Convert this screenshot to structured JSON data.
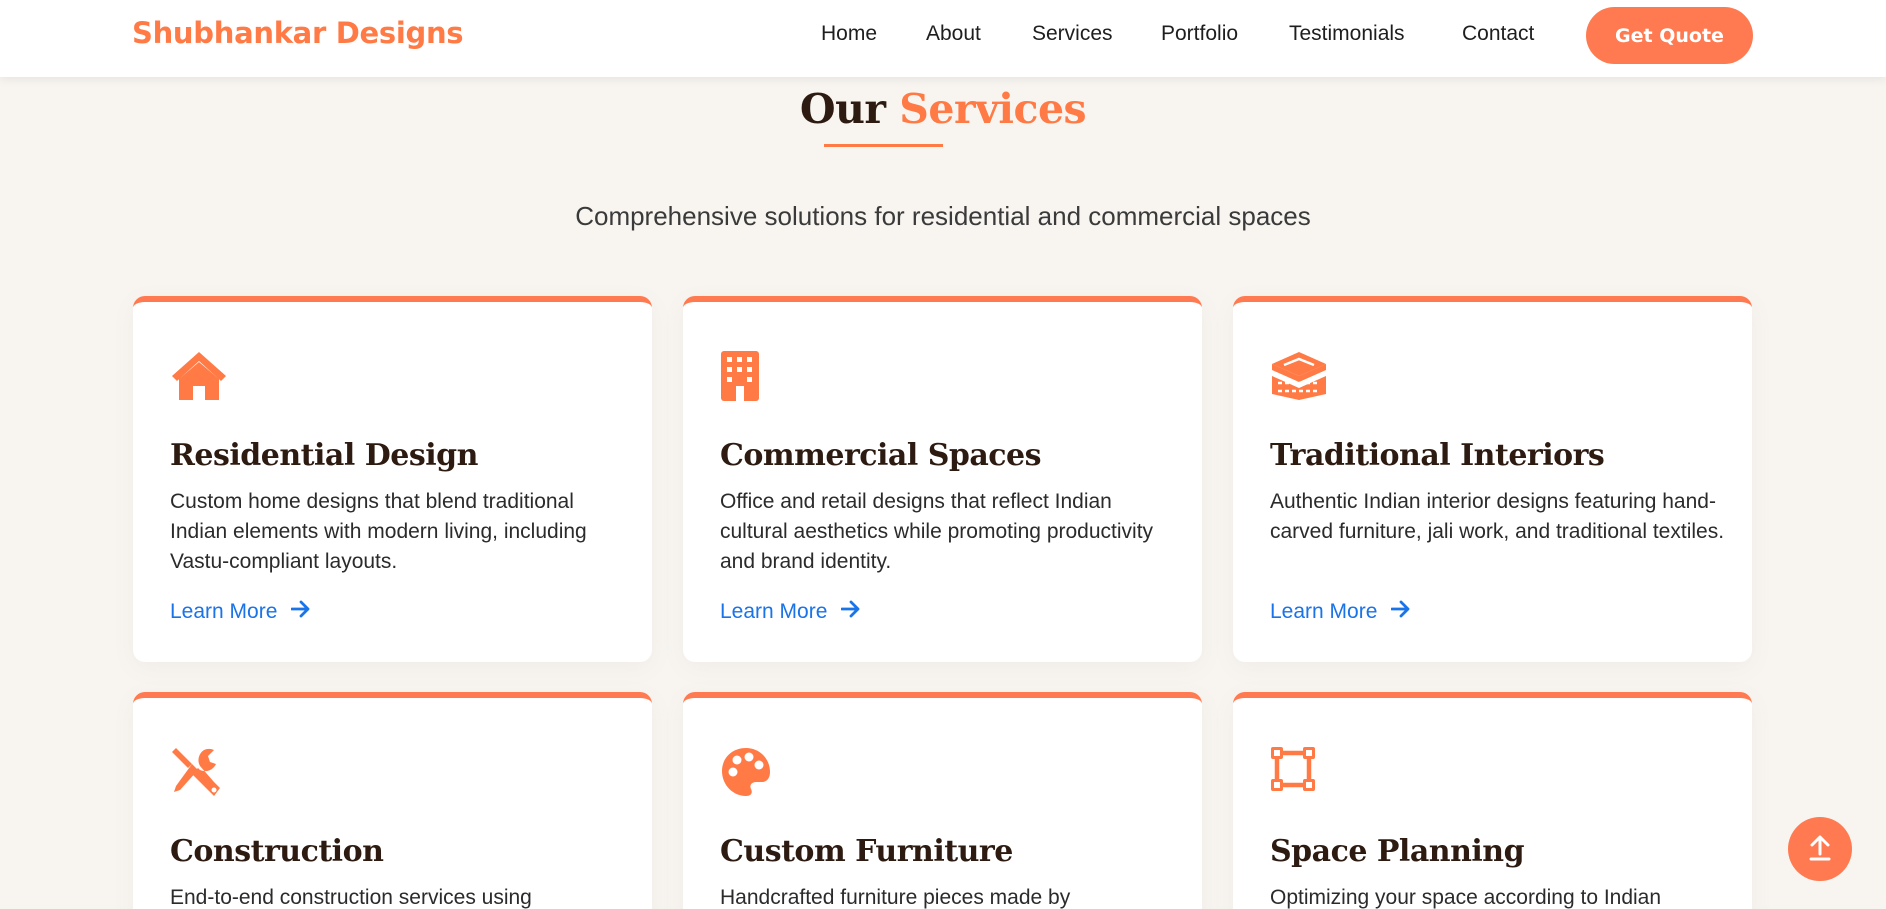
{
  "brand": {
    "name": "Shubhankar Designs"
  },
  "nav": {
    "items": [
      {
        "label": "Home"
      },
      {
        "label": "About"
      },
      {
        "label": "Services"
      },
      {
        "label": "Portfolio"
      },
      {
        "label": "Testimonials"
      },
      {
        "label": "Contact"
      }
    ],
    "cta_label": "Get Quote"
  },
  "section": {
    "title_part1": "Our",
    "title_part2": "Services",
    "subtitle": "Comprehensive solutions for residential and commercial spaces"
  },
  "services": [
    {
      "icon": "home-icon",
      "title": "Residential Design",
      "description": "Custom home designs that blend traditional Indian elements with modern living, including Vastu-compliant layouts.",
      "link": "Learn More"
    },
    {
      "icon": "building-icon",
      "title": "Commercial Spaces",
      "description": "Office and retail designs that reflect Indian cultural aesthetics while promoting productivity and brand identity.",
      "link": "Learn More"
    },
    {
      "icon": "layers-icon",
      "title": "Traditional Interiors",
      "description": "Authentic Indian interior designs featuring hand-carved furniture, jali work, and traditional textiles.",
      "link": "Learn More"
    },
    {
      "icon": "tools-icon",
      "title": "Construction",
      "description": "End-to-end construction services using",
      "link": ""
    },
    {
      "icon": "palette-icon",
      "title": "Custom Furniture",
      "description": "Handcrafted furniture pieces made by",
      "link": ""
    },
    {
      "icon": "vector-square-icon",
      "title": "Space Planning",
      "description": "Optimizing your space according to Indian",
      "link": ""
    }
  ],
  "colors": {
    "accent": "#ff7a45",
    "link": "#1a73e8",
    "background": "#f8f5f1",
    "heading": "#2d1b12"
  }
}
